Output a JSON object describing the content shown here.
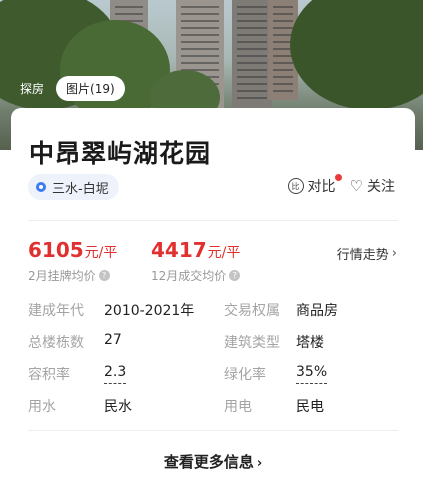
{
  "photo_tabs": {
    "tab_1": "探房",
    "tab_2": "图片(19)"
  },
  "property": {
    "name": "中昂翠屿湖花园",
    "location": "三水-白坭"
  },
  "actions": {
    "compare_label": "对比",
    "compare_icon_text": "比",
    "follow_label": "关注"
  },
  "prices": {
    "listing": {
      "value": "6105",
      "unit": "元/平",
      "caption": "2月挂牌均价"
    },
    "deal": {
      "value": "4417",
      "unit": "元/平",
      "caption": "12月成交均价"
    },
    "trend_label": "行情走势"
  },
  "attributes": [
    {
      "label": "建成年代",
      "value": "2010-2021年"
    },
    {
      "label": "交易权属",
      "value": "商品房"
    },
    {
      "label": "总楼栋数",
      "value": "27"
    },
    {
      "label": "建筑类型",
      "value": "塔楼"
    },
    {
      "label": "容积率",
      "value": "2.3"
    },
    {
      "label": "绿化率",
      "value": "35%"
    },
    {
      "label": "用水",
      "value": "民水"
    },
    {
      "label": "用电",
      "value": "民电"
    }
  ],
  "more_button": "查看更多信息",
  "colors": {
    "price_red": "#e13030",
    "accent_blue": "#3e7bf0",
    "notify_red": "#e93b3b"
  }
}
